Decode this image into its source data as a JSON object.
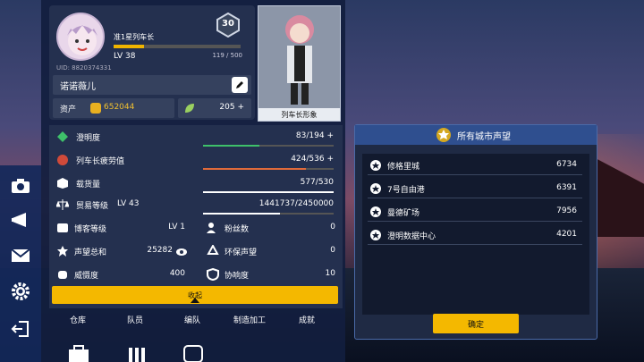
{
  "profile": {
    "rank": "准1星列车长",
    "level": "LV 38",
    "exp": "119 / 500",
    "exp_fraction": 0.238,
    "uid": "UID: 8820374331",
    "name": "诺诺薇儿",
    "badge": "30"
  },
  "assets": {
    "label": "资产",
    "coins": "652044",
    "energy": "205 +"
  },
  "portrait": {
    "label": "列车长形象"
  },
  "stats": [
    {
      "label": "澄明度",
      "value": "83/194 +",
      "fraction": 0.43,
      "color": "#3ec06a"
    },
    {
      "label": "列车长疲劳值",
      "value": "424/536 +",
      "fraction": 0.79,
      "color": "#e06a3a"
    },
    {
      "label": "载货量",
      "value": "577/530",
      "fraction": 1.0,
      "color": "#ffffff"
    },
    {
      "label": "贸易等级",
      "level": "LV 43",
      "value": "1441737/2450000",
      "fraction": 0.59,
      "color": "#ffffff"
    }
  ],
  "grid": [
    {
      "label": "博客等级",
      "value": "LV 1"
    },
    {
      "label": "粉丝数",
      "value": "0"
    },
    {
      "label": "声望总和",
      "value": "25282"
    },
    {
      "label": "环保声望",
      "value": "0"
    },
    {
      "label": "威慑度",
      "value": "400"
    },
    {
      "label": "协响度",
      "value": "10"
    }
  ],
  "collapse_label": "收起",
  "nav": [
    "仓库",
    "队员",
    "编队",
    "制造加工",
    "成就"
  ],
  "dialog": {
    "title": "所有城市声望",
    "ok": "确定",
    "cities": [
      {
        "name": "修格里城",
        "value": "6734"
      },
      {
        "name": "7号自由港",
        "value": "6391"
      },
      {
        "name": "曼德矿场",
        "value": "7956"
      },
      {
        "name": "澄明数据中心",
        "value": "4201"
      }
    ]
  },
  "sidebar": [
    "camera-icon",
    "announce-icon",
    "mail-icon",
    "settings-icon",
    "exit-icon"
  ]
}
